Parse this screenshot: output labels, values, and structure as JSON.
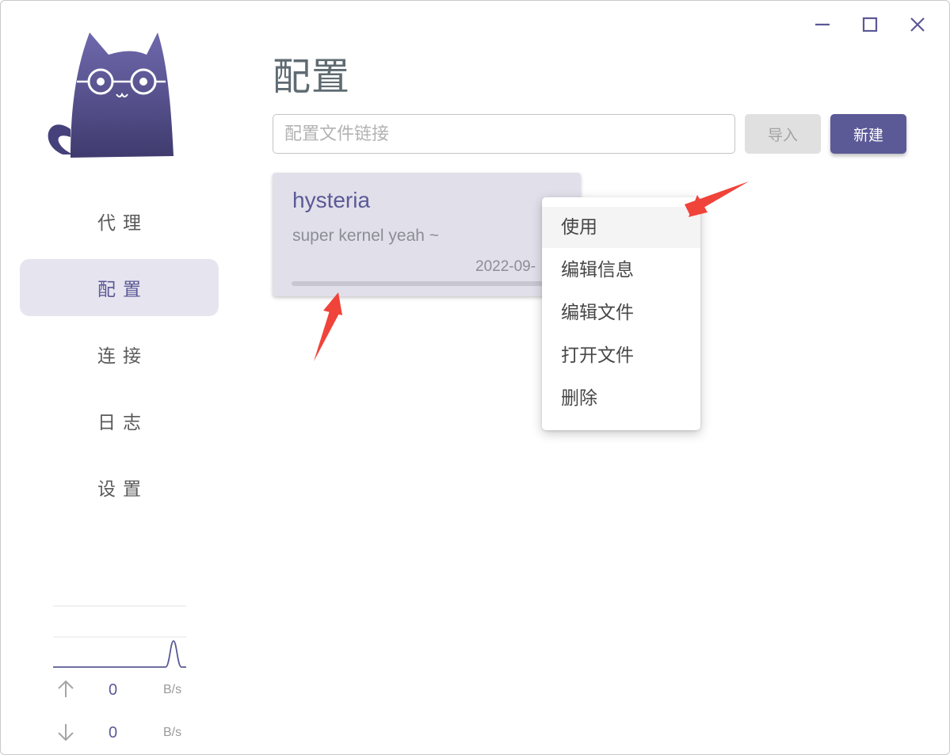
{
  "window": {
    "controls": [
      {
        "name": "minimize-icon"
      },
      {
        "name": "maximize-icon"
      },
      {
        "name": "close-icon"
      }
    ]
  },
  "sidebar": {
    "logo": "cat-logo-icon",
    "items": [
      {
        "label": "代理",
        "active": false
      },
      {
        "label": "配置",
        "active": true
      },
      {
        "label": "连接",
        "active": false
      },
      {
        "label": "日志",
        "active": false
      },
      {
        "label": "设置",
        "active": false
      }
    ],
    "traffic": {
      "upload": {
        "icon": "arrow-up-icon",
        "value": "0",
        "unit": "B/s"
      },
      "download": {
        "icon": "arrow-down-icon",
        "value": "0",
        "unit": "B/s"
      }
    }
  },
  "main": {
    "title": "配置",
    "url_input": {
      "placeholder": "配置文件链接",
      "value": ""
    },
    "import_label": "导入",
    "new_label": "新建",
    "profiles": [
      {
        "name": "hysteria",
        "desc": "super kernel yeah ~",
        "date": "2022-09-"
      }
    ]
  },
  "context_menu": {
    "items": [
      {
        "label": "使用",
        "hover": true
      },
      {
        "label": "编辑信息",
        "hover": false
      },
      {
        "label": "编辑文件",
        "hover": false
      },
      {
        "label": "打开文件",
        "hover": false
      },
      {
        "label": "删除",
        "hover": false
      }
    ]
  },
  "colors": {
    "accent": "#5b5996",
    "nav_active_bg": "#e6e5ef",
    "card_bg": "#e1e0ea",
    "annotation_arrow": "#f0433a"
  }
}
